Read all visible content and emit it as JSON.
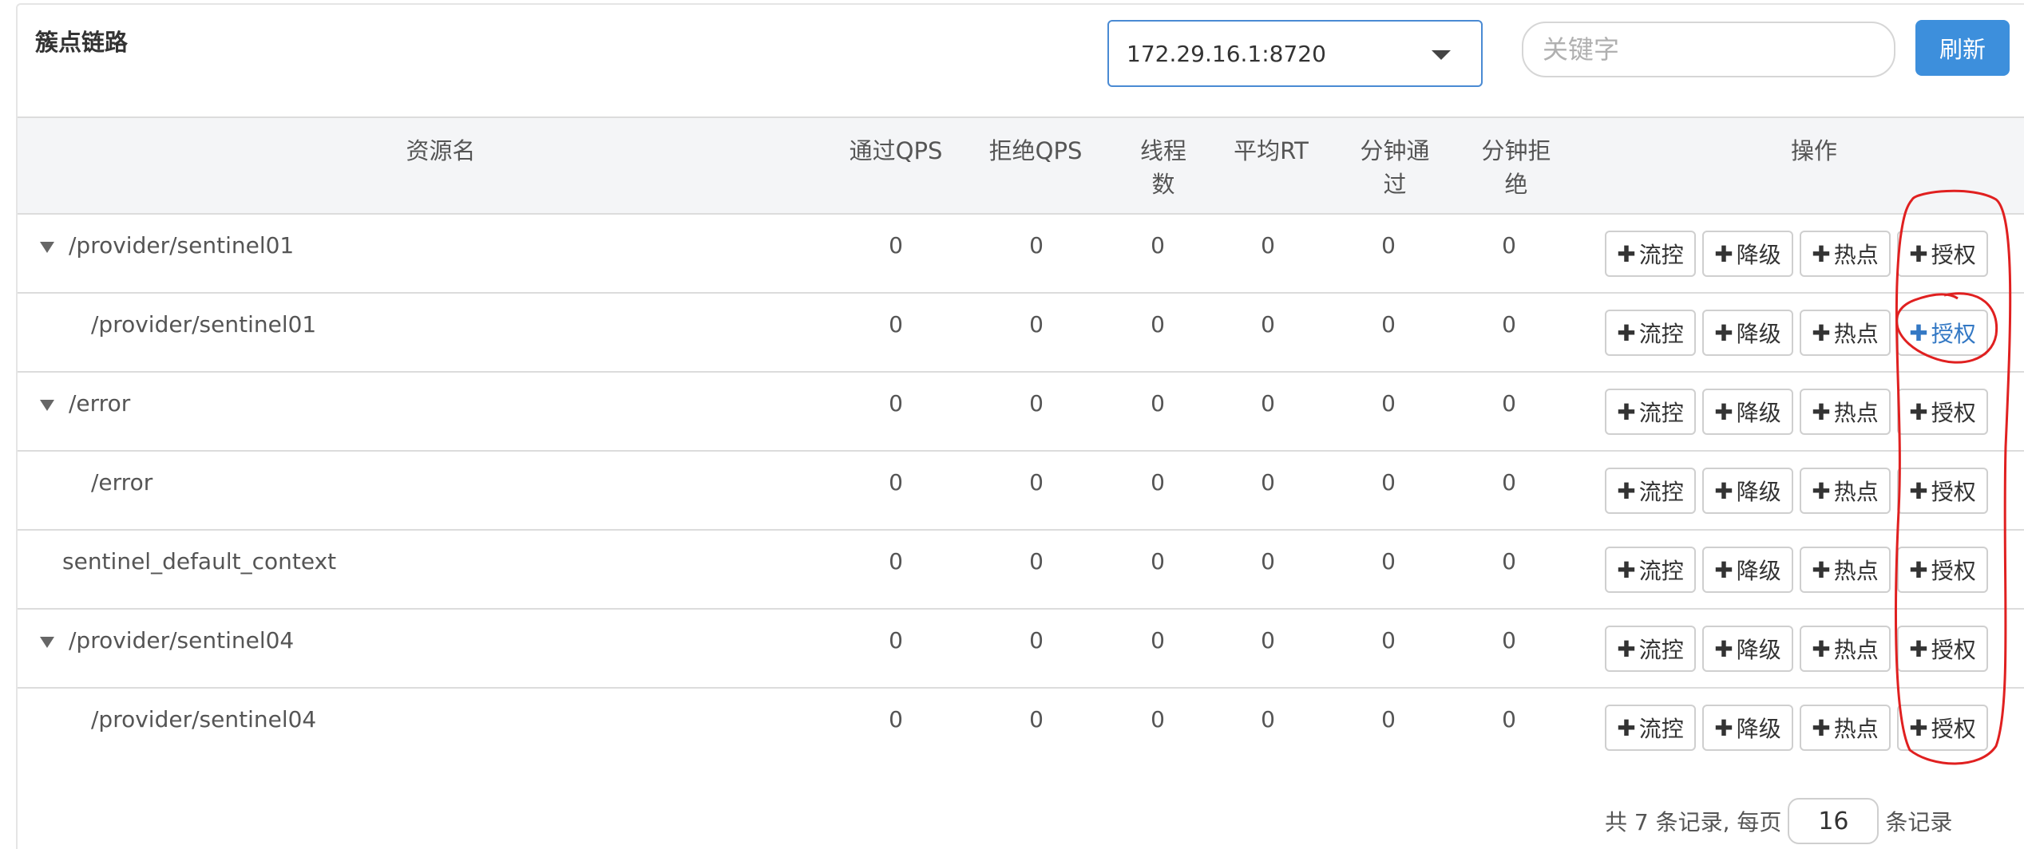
{
  "panel": {
    "title": "簇点链路",
    "machine_select": {
      "value": "172.29.16.1:8720"
    },
    "search": {
      "placeholder": "关键字",
      "value": ""
    },
    "refresh_label": "刷新"
  },
  "table": {
    "columns": [
      "资源名",
      "通过QPS",
      "拒绝QPS",
      "线程数",
      "平均RT",
      "分钟通过",
      "分钟拒绝",
      "操作"
    ],
    "column_lines": {
      "thread": [
        "线程",
        "数"
      ],
      "min_pass": [
        "分钟通",
        "过"
      ],
      "min_block": [
        "分钟拒",
        "绝"
      ]
    },
    "actions": {
      "flow": "流控",
      "degrade": "降级",
      "hot": "热点",
      "auth": "授权",
      "plus": "✚"
    },
    "rows": [
      {
        "resource": "/provider/sentinel01",
        "pass_qps": "0",
        "block_qps": "0",
        "threads": "0",
        "avg_rt": "0",
        "min_pass": "0",
        "min_block": "0"
      },
      {
        "resource": "/provider/sentinel01",
        "pass_qps": "0",
        "block_qps": "0",
        "threads": "0",
        "avg_rt": "0",
        "min_pass": "0",
        "min_block": "0"
      },
      {
        "resource": "/error",
        "pass_qps": "0",
        "block_qps": "0",
        "threads": "0",
        "avg_rt": "0",
        "min_pass": "0",
        "min_block": "0"
      },
      {
        "resource": "/error",
        "pass_qps": "0",
        "block_qps": "0",
        "threads": "0",
        "avg_rt": "0",
        "min_pass": "0",
        "min_block": "0"
      },
      {
        "resource": "sentinel_default_context",
        "pass_qps": "0",
        "block_qps": "0",
        "threads": "0",
        "avg_rt": "0",
        "min_pass": "0",
        "min_block": "0"
      },
      {
        "resource": "/provider/sentinel04",
        "pass_qps": "0",
        "block_qps": "0",
        "threads": "0",
        "avg_rt": "0",
        "min_pass": "0",
        "min_block": "0"
      },
      {
        "resource": "/provider/sentinel04",
        "pass_qps": "0",
        "block_qps": "0",
        "threads": "0",
        "avg_rt": "0",
        "min_pass": "0",
        "min_block": "0"
      }
    ]
  },
  "pagination": {
    "prefix": "共 7 条记录, 每页",
    "page_size": "16",
    "suffix": "条记录"
  },
  "colors": {
    "accent": "#3d8fdc",
    "annotation": "#e02020",
    "highlight_text": "#3378c4"
  }
}
